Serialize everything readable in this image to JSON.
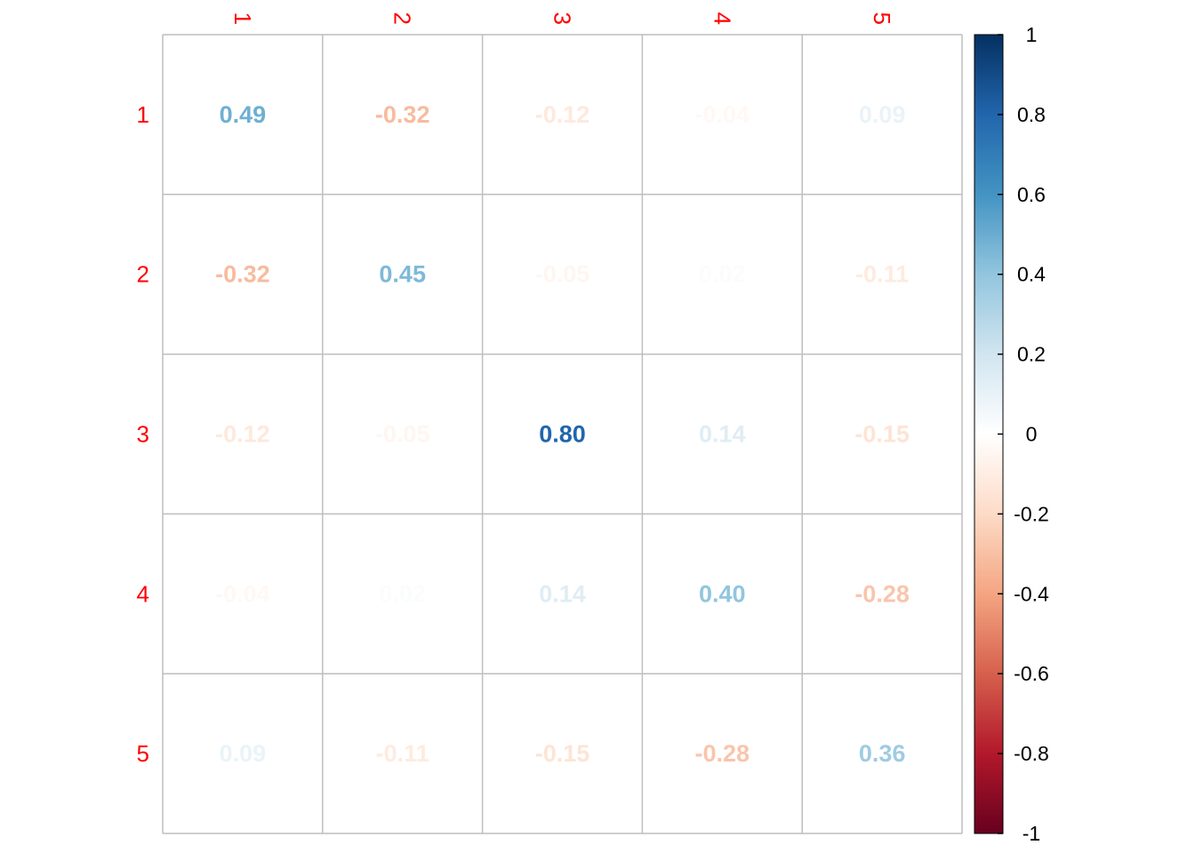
{
  "chart_data": {
    "type": "heatmap",
    "row_labels": [
      "1",
      "2",
      "3",
      "4",
      "5"
    ],
    "col_labels": [
      "1",
      "2",
      "3",
      "4",
      "5"
    ],
    "label_color": "#ff0000",
    "values": [
      [
        0.49,
        -0.32,
        -0.12,
        -0.04,
        0.09
      ],
      [
        -0.32,
        0.45,
        -0.05,
        0.02,
        -0.11
      ],
      [
        -0.12,
        -0.05,
        0.8,
        0.14,
        -0.15
      ],
      [
        -0.04,
        0.02,
        0.14,
        0.4,
        -0.28
      ],
      [
        0.09,
        -0.11,
        -0.15,
        -0.28,
        0.36
      ]
    ],
    "value_labels": [
      [
        "0.49",
        "-0.32",
        "-0.12",
        "-0.04",
        "0.09"
      ],
      [
        "-0.32",
        "0.45",
        "-0.05",
        "0.02",
        "-0.11"
      ],
      [
        "-0.12",
        "-0.05",
        "0.80",
        "0.14",
        "-0.15"
      ],
      [
        "-0.04",
        "0.02",
        "0.14",
        "0.40",
        "-0.28"
      ],
      [
        "0.09",
        "-0.11",
        "-0.15",
        "-0.28",
        "0.36"
      ]
    ],
    "color_range": [
      -1,
      1
    ],
    "colorbar_ticks": [
      1,
      0.8,
      0.6,
      0.4,
      0.2,
      0,
      -0.2,
      -0.4,
      -0.6,
      -0.8,
      -1
    ],
    "colorbar_tick_labels": [
      "1",
      "0.8",
      "0.6",
      "0.4",
      "0.2",
      "0",
      "-0.2",
      "-0.4",
      "-0.6",
      "-0.8",
      "-1"
    ],
    "palette": [
      "#67001F",
      "#B2182B",
      "#D6604D",
      "#F4A582",
      "#FDDBC7",
      "#FFFFFF",
      "#D1E5F0",
      "#92C5DE",
      "#4393C3",
      "#2166AC",
      "#053061"
    ],
    "grid": true,
    "grid_color": "#bebebe",
    "legend": "right"
  }
}
